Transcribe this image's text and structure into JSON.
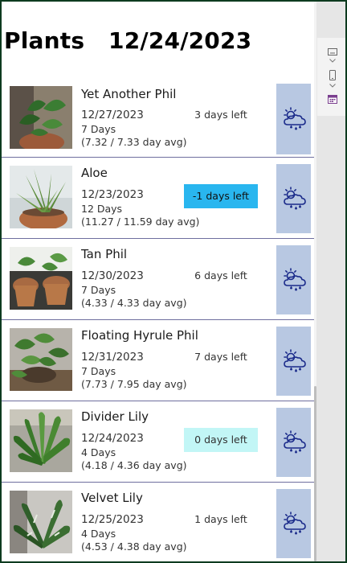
{
  "header": {
    "title": "Plants   12/24/2023"
  },
  "plants": [
    {
      "name": "Yet Another Phil",
      "date": "12/27/2023",
      "days": "7 Days",
      "avg": "(7.32 / 7.33 day avg)",
      "left": "3 days left",
      "status": "normal"
    },
    {
      "name": "Aloe",
      "date": "12/23/2023",
      "days": "12 Days",
      "avg": "(11.27 / 11.59 day avg)",
      "left": "-1 days left",
      "status": "overdue"
    },
    {
      "name": "Tan Phil",
      "date": "12/30/2023",
      "days": "7 Days",
      "avg": "(4.33 / 4.33 day avg)",
      "left": "6 days left",
      "status": "normal"
    },
    {
      "name": "Floating Hyrule Phil",
      "date": "12/31/2023",
      "days": "7 Days",
      "avg": "(7.73 / 7.95 day avg)",
      "left": "7 days left",
      "status": "normal"
    },
    {
      "name": "Divider Lily",
      "date": "12/24/2023",
      "days": "4 Days",
      "avg": "(4.18 / 4.36 day avg)",
      "left": "0 days left",
      "status": "today"
    },
    {
      "name": "Velvet Lily",
      "date": "12/25/2023",
      "days": "4 Days",
      "avg": "(4.53 / 4.38 day avg)",
      "left": "1 days left",
      "status": "normal"
    }
  ],
  "icons": {
    "weather": "sun-cloud-rain-icon",
    "side_tools": [
      "screen-icon",
      "chevron-down-icon",
      "phone-icon",
      "chevron-down-icon",
      "calendar-icon"
    ]
  },
  "colors": {
    "weather_button": "#b8c8e2",
    "overdue": "#29b6ef",
    "today": "#c2f6f6",
    "icon_stroke": "#1a2a8a"
  }
}
